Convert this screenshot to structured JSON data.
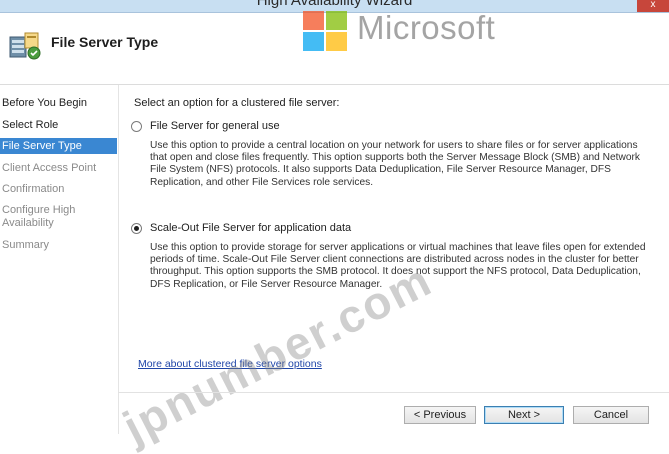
{
  "window": {
    "title": "High Availability Wizard",
    "close_glyph": "x"
  },
  "header": {
    "page_title": "File Server Type",
    "icon": "file-server-wizard-icon"
  },
  "watermark": {
    "logo_text": "Microsoft",
    "overlay_text": "jpnumber.com"
  },
  "sidebar": {
    "items": [
      {
        "label": "Before You Begin",
        "state": "done"
      },
      {
        "label": "Select Role",
        "state": "done"
      },
      {
        "label": "File Server Type",
        "state": "active"
      },
      {
        "label": "Client Access Point",
        "state": "pending"
      },
      {
        "label": "Confirmation",
        "state": "pending"
      },
      {
        "label": "Configure High\nAvailability",
        "state": "pending"
      },
      {
        "label": "Summary",
        "state": "pending"
      }
    ]
  },
  "main": {
    "prompt": "Select an option for a clustered file server:",
    "options": [
      {
        "label": "File Server for general use",
        "checked": false,
        "description": "Use this option to provide a central location on your network for users to share files or for server applications that open and close files frequently. This option supports both the Server Message Block (SMB) and Network File System (NFS) protocols. It also supports Data Deduplication, File Server Resource Manager, DFS Replication, and other File Services role services."
      },
      {
        "label": "Scale-Out File Server for application data",
        "checked": true,
        "description": "Use this option to provide storage for server applications or virtual machines that leave files open for extended periods of time. Scale-Out File Server client connections are distributed across nodes in the cluster for better throughput. This option supports the SMB protocol. It does not support the NFS protocol, Data Deduplication, DFS Replication, or File Server Resource Manager."
      }
    ],
    "link": "More about clustered file server options"
  },
  "footer": {
    "previous_label": "< Previous",
    "next_label": "Next >",
    "cancel_label": "Cancel"
  },
  "colors": {
    "accent": "#3a87d2",
    "link": "#2046a8",
    "titlebar": "#c8dff2",
    "close": "#c7463b"
  }
}
